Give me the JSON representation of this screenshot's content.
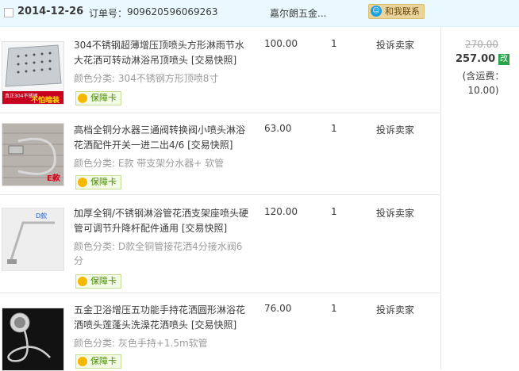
{
  "order": {
    "date": "2014-12-26",
    "order_label": "订单号：",
    "order_no": "909620596069263",
    "shop": "嘉尔朗五金...",
    "contact": "和我联系"
  },
  "items": [
    {
      "title": "304不锈钢超薄增压顶喷头方形淋雨节水大花洒可转动淋浴吊顶喷头 [交易快照]",
      "spec": "颜色分类: 304不锈钢方形顶喷8寸",
      "guarantee": "保障卡",
      "price": "100.00",
      "qty": "1",
      "complain": "投诉卖家"
    },
    {
      "title": "高档全铜分水器三通阀转换阀小喷头淋浴花洒配件开关一进二出4/6 [交易快照]",
      "spec": "颜色分类: E款 带支架分水器+ 软管",
      "guarantee": "保障卡",
      "price": "63.00",
      "qty": "1",
      "complain": "投诉卖家"
    },
    {
      "title": "加厚全铜/不锈钢淋浴管花洒支架座喷头硬管可调节升降杆配件通用 [交易快照]",
      "spec": "颜色分类: D款全铜管接花洒4分接水阀6分",
      "guarantee": "保障卡",
      "price": "120.00",
      "qty": "1",
      "complain": "投诉卖家"
    },
    {
      "title": "五金卫浴增压五功能手持花洒圆形淋浴花洒喷头莲蓬头洗澡花洒喷头 [交易快照]",
      "spec": "颜色分类: 灰色手持+1.5m软管",
      "guarantee": "保障卡",
      "price": "76.00",
      "qty": "1",
      "complain": "投诉卖家"
    }
  ],
  "total": {
    "original": "270.00",
    "final": "257.00",
    "modified_tag": "改",
    "shipping": "(含运费：10.00)"
  },
  "thumb_text": {
    "item1_badge": "不怕暗装",
    "item1_note": "真正304不锈钢",
    "item2_badge": "E款",
    "item3_badge": "D款"
  }
}
